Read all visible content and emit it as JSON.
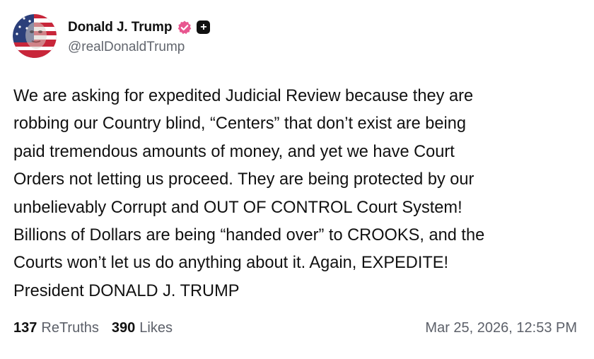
{
  "author": {
    "display_name": "Donald J. Trump",
    "handle": "@realDonaldTrump",
    "avatar_icon": "portrait-flag-avatar",
    "verified_icon": "verified-badge-icon",
    "verified_color": "#e8568f",
    "subscriber_icon": "plus-badge-icon",
    "subscriber_glyph": "+"
  },
  "post": {
    "lines": [
      "We are asking for expedited Judicial Review because they are",
      "robbing our Country blind, “Centers” that don’t exist are being",
      "paid tremendous amounts of money, and yet we have Court",
      "Orders not letting us proceed. They are being protected by our",
      "unbelievably Corrupt and OUT OF CONTROL Court System!",
      "Billions of Dollars are being “handed over” to CROOKS, and the",
      "Courts won’t let us do anything about it. Again, EXPEDITE!",
      "President DONALD J. TRUMP"
    ]
  },
  "stats": {
    "retruths_count": "137",
    "retruths_label": "ReTruths",
    "likes_count": "390",
    "likes_label": "Likes"
  },
  "timestamp": "Mar 25, 2026, 12:53 PM"
}
